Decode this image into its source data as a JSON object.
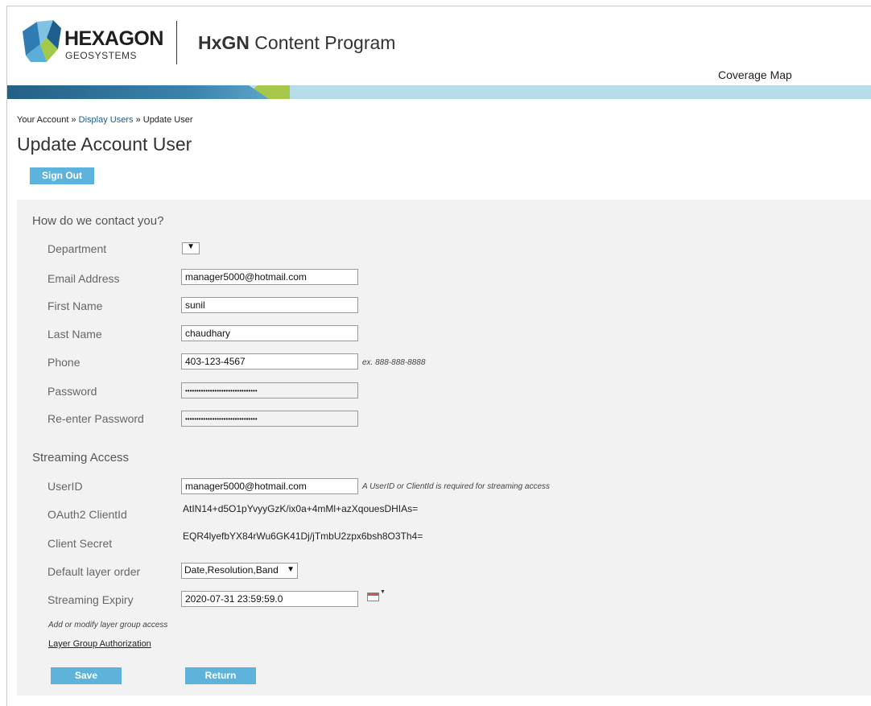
{
  "header": {
    "logo_name": "HEXAGON",
    "logo_sub": "GEOSYSTEMS",
    "program_bold": "HxGN",
    "program_rest": " Content Program",
    "coverage_link": "Coverage Map"
  },
  "breadcrumb": {
    "item1": "Your Account",
    "sep": " » ",
    "item2": "Display Users",
    "item3": "Update User"
  },
  "page_title": "Update Account User",
  "sign_out_label": "Sign Out",
  "contact": {
    "heading": "How do we contact you?",
    "department_label": "Department",
    "department_value": "",
    "email_label": "Email Address",
    "email_value": "manager5000@hotmail.com",
    "first_label": "First Name",
    "first_value": "sunil",
    "last_label": "Last Name",
    "last_value": "chaudhary",
    "phone_label": "Phone",
    "phone_value": "403-123-4567",
    "phone_hint": "ex. 888-888-8888",
    "password_label": "Password",
    "password_value": "••••••••••••••••••••••••••••••••",
    "repassword_label": "Re-enter Password",
    "repassword_value": "••••••••••••••••••••••••••••••••"
  },
  "streaming": {
    "heading": "Streaming Access",
    "userid_label": "UserID",
    "userid_value": "manager5000@hotmail.com",
    "userid_hint": "A UserID or ClientId is required for streaming access",
    "clientid_label": "OAuth2 ClientId",
    "clientid_value": "AtIN14+d5O1pYvyyGzK/ix0a+4mMl+azXqouesDHIAs=",
    "secret_label": "Client Secret",
    "secret_value": "EQR4lyefbYX84rWu6GK41Dj/jTmbU2zpx6bsh8O3Th4=",
    "layer_order_label": "Default layer order",
    "layer_order_value": "Date,Resolution,Band",
    "expiry_label": "Streaming Expiry",
    "expiry_value": "2020-07-31 23:59:59.0",
    "layer_group_note": "Add or modify layer group access",
    "layer_group_link": "Layer Group Authorization"
  },
  "actions": {
    "save": "Save",
    "return": "Return"
  },
  "colors": {
    "button": "#5db3db",
    "band_light": "#b6dce9",
    "band_dark": "#2a6d96",
    "band_green": "#a6c74b",
    "panel": "#f2f2f2"
  }
}
